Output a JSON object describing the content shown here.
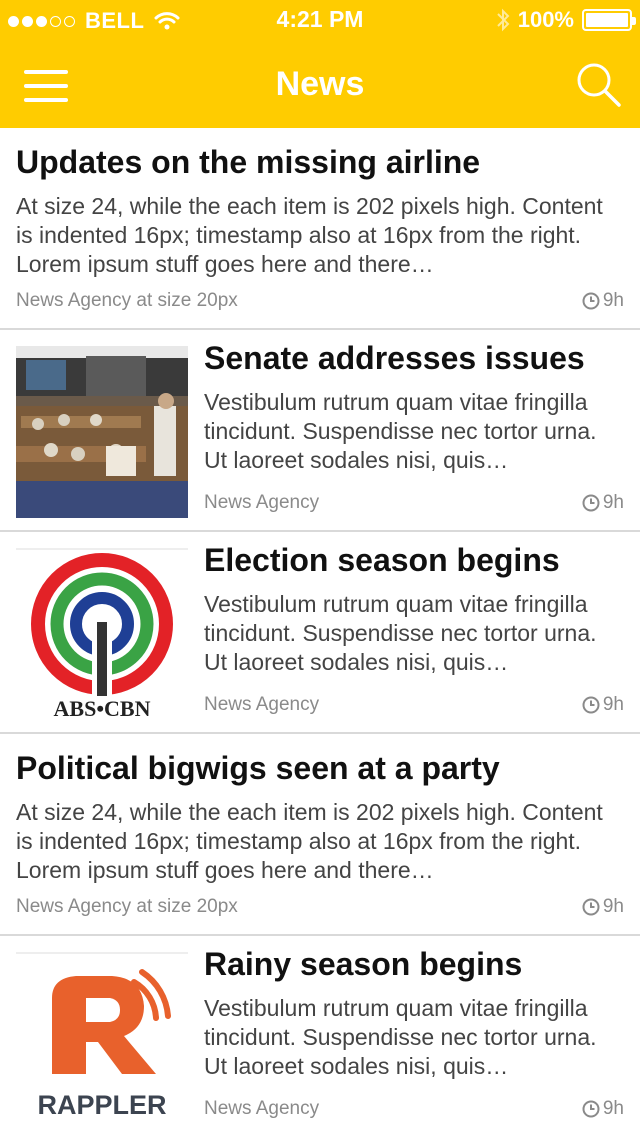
{
  "status_bar": {
    "carrier": "BELL",
    "time": "4:21 PM",
    "battery": "100%"
  },
  "nav": {
    "title": "News",
    "menu_icon": "hamburger-icon",
    "search_icon": "search-icon"
  },
  "colors": {
    "header": "#FFCC00",
    "text": "#111111",
    "meta": "#8a8a8a"
  },
  "articles": [
    {
      "title": "Updates on the missing airline",
      "body": "At size 24, while the each item is 202 pixels high. Content is indented 16px; timestamp also at 16px from the right. Lorem ipsum stuff goes here and there…",
      "source": "News Agency at size 20px",
      "time": "9h",
      "image": null
    },
    {
      "title": "Senate addresses issues",
      "body": "Vestibulum rutrum quam vitae fringilla tincidunt. Suspendisse nec tortor urna. Ut laoreet sodales nisi, quis…",
      "source": "News Agency",
      "time": "9h",
      "image": "senate-photo"
    },
    {
      "title": "Election season begins",
      "body": "Vestibulum rutrum quam vitae fringilla tincidunt. Suspendisse nec tortor urna. Ut laoreet sodales nisi, quis…",
      "source": "News Agency",
      "time": "9h",
      "image": "abs-cbn-logo",
      "image_text": "ABS•CBN"
    },
    {
      "title": "Political bigwigs seen at a party",
      "body": "At size 24, while the each item is 202 pixels high. Content is indented 16px; timestamp also at 16px from the right. Lorem ipsum stuff goes here and there…",
      "source": "News Agency at size 20px",
      "time": "9h",
      "image": null
    },
    {
      "title": "Rainy season begins",
      "body": "Vestibulum rutrum quam vitae fringilla tincidunt. Suspendisse nec tortor urna. Ut laoreet sodales nisi, quis…",
      "source": "News Agency",
      "time": "9h",
      "image": "rappler-logo",
      "image_text": "RAPPLER"
    }
  ]
}
